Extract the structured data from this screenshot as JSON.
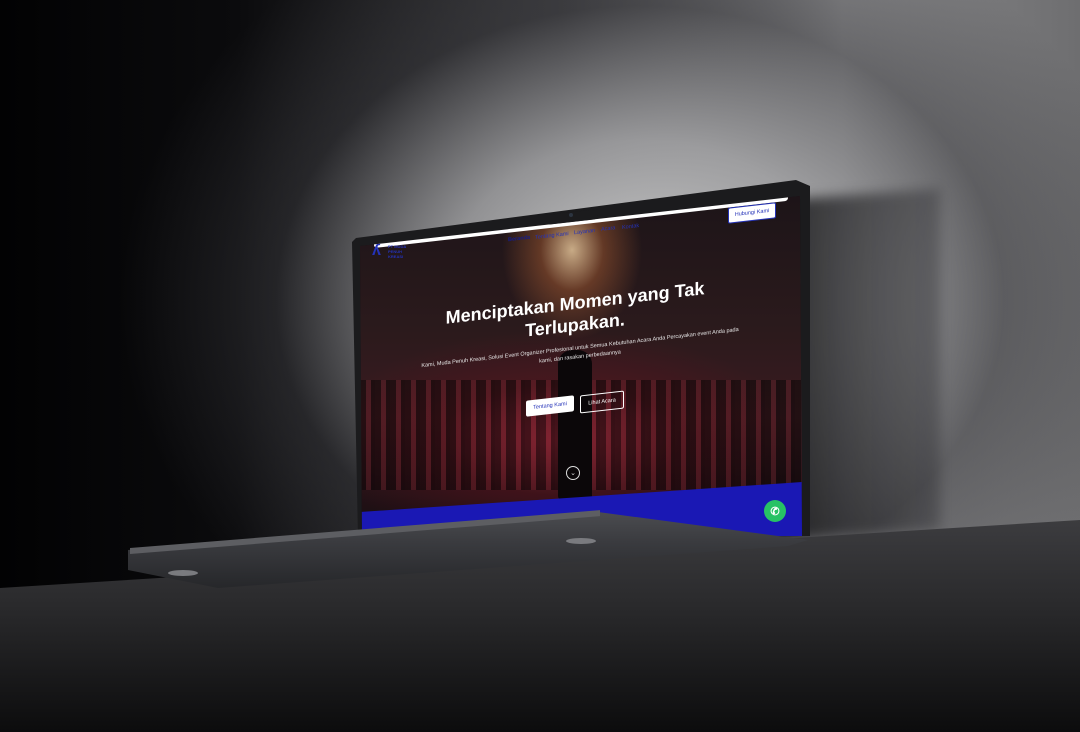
{
  "site": {
    "logo_text": "PT MUDA PENUH KREASI",
    "nav": [
      "Beranda",
      "Tentang Kami",
      "Layanan",
      "Acara",
      "Kontak"
    ],
    "cta": "Hubungi Kami"
  },
  "hero": {
    "title": "Menciptakan Momen yang Tak Terlupakan.",
    "subtitle": "Kami, Muda Penuh Kreasi, Solusi Event Organizer Profesional untuk Semua Kebutuhan Acara Anda Percayakan event Anda pada kami, dan rasakan perbedaannya",
    "primary_button": "Tentang Kami",
    "secondary_button": "Lihat Acara"
  },
  "colors": {
    "brand": "#2432b8",
    "band": "#1a18b4",
    "whatsapp": "#27c265"
  },
  "icons": {
    "logo": "logo-icon",
    "scroll": "chevron-down-icon",
    "whatsapp": "whatsapp-icon"
  }
}
